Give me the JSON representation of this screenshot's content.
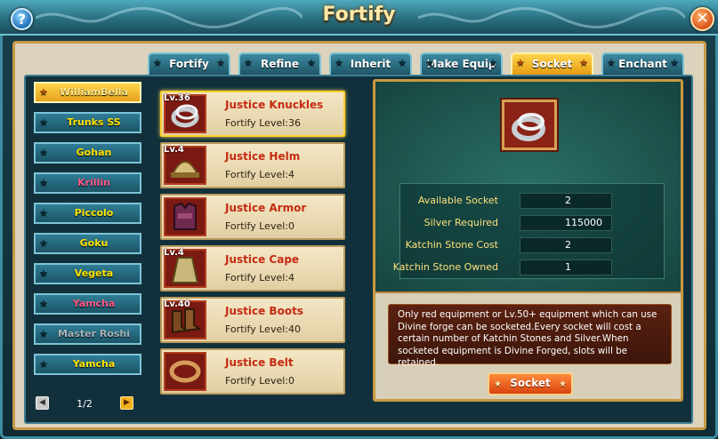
{
  "window": {
    "title": "Fortify",
    "help_label": "?",
    "close_label": "✕"
  },
  "tabs": [
    {
      "label": "Fortify",
      "active": false
    },
    {
      "label": "Refine",
      "active": false
    },
    {
      "label": "Inherit",
      "active": false
    },
    {
      "label": "Make Equip",
      "active": false
    },
    {
      "label": "Socket",
      "active": true
    },
    {
      "label": "Enchant",
      "active": false
    }
  ],
  "characters": [
    {
      "name": "WilliamBella",
      "color": "#ffe98a",
      "active": true
    },
    {
      "name": "Trunks SS",
      "color": "#ffe400"
    },
    {
      "name": "Gohan",
      "color": "#ffe400"
    },
    {
      "name": "Krillin",
      "color": "#ff5a8a"
    },
    {
      "name": "Piccolo",
      "color": "#ffe400"
    },
    {
      "name": "Goku",
      "color": "#ffe400"
    },
    {
      "name": "Vegeta",
      "color": "#ffe400"
    },
    {
      "name": "Yamcha",
      "color": "#ff5a8a"
    },
    {
      "name": "Master Roshi",
      "color": "#a9b5b8"
    },
    {
      "name": "Yamcha",
      "color": "#ffe400"
    }
  ],
  "pager": {
    "text": "1/2",
    "prev_icon": "arrow-left-icon",
    "next_icon": "arrow-right-icon"
  },
  "equipment": [
    {
      "level": "Lv.36",
      "name": "Justice Knuckles",
      "fortify": "Fortify Level:36",
      "icon": "knuckles-icon",
      "selected": true
    },
    {
      "level": "Lv.4",
      "name": "Justice Helm",
      "fortify": "Fortify Level:4",
      "icon": "helm-icon"
    },
    {
      "level": "",
      "name": "Justice Armor",
      "fortify": "Fortify Level:0",
      "icon": "armor-icon"
    },
    {
      "level": "Lv.4",
      "name": "Justice Cape",
      "fortify": "Fortify Level:4",
      "icon": "cape-icon"
    },
    {
      "level": "Lv.40",
      "name": "Justice Boots",
      "fortify": "Fortify Level:40",
      "icon": "boots-icon"
    },
    {
      "level": "",
      "name": "Justice Belt",
      "fortify": "Fortify Level:0",
      "icon": "belt-icon"
    }
  ],
  "detail": {
    "stats": [
      {
        "label": "Available Socket",
        "value": "2"
      },
      {
        "label": "Silver Required",
        "value": "115000"
      },
      {
        "label": "Katchin Stone Cost",
        "value": "2"
      },
      {
        "label": "Katchin Stone Owned",
        "value": "1"
      }
    ],
    "note": "Only red equipment or Lv.50+ equipment which can use Divine forge can be socketed.Every socket will cost a certain number of Katchin Stones and Silver.When socketed equipment is Divine Forged, slots will be retained.",
    "button_label": "Socket"
  }
}
